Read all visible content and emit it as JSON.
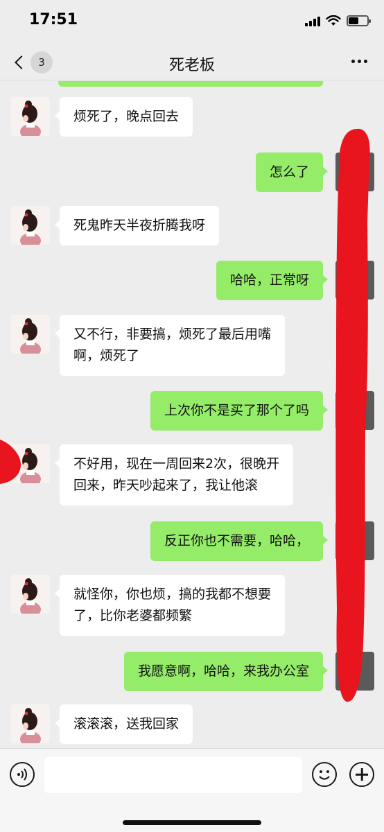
{
  "status_bar": {
    "time": "17:51"
  },
  "nav": {
    "unread_count": "3",
    "title": "死老板"
  },
  "messages": [
    {
      "from": "her",
      "lines": [
        "烦死了，晚点回去"
      ]
    },
    {
      "from": "me",
      "lines": [
        "怎么了"
      ]
    },
    {
      "from": "her",
      "lines": [
        "死鬼昨天半夜折腾我呀"
      ]
    },
    {
      "from": "me",
      "lines": [
        "哈哈，正常呀"
      ]
    },
    {
      "from": "her",
      "lines": [
        "又不行，非要搞，烦死了最后用嘴",
        "啊，烦死了"
      ]
    },
    {
      "from": "me",
      "lines": [
        "上次你不是买了那个了吗"
      ]
    },
    {
      "from": "her",
      "lines": [
        "不好用，现在一周回来2次，很晚开",
        "回来，昨天吵起来了，我让他滚"
      ]
    },
    {
      "from": "me",
      "lines": [
        "反正你也不需要，哈哈，"
      ]
    },
    {
      "from": "her",
      "lines": [
        "就怪你，你也烦，搞的我都不想要",
        "了，比你老婆都频繁"
      ]
    },
    {
      "from": "me",
      "lines": [
        "我愿意啊，哈哈，来我办公室"
      ]
    },
    {
      "from": "her",
      "lines": [
        "滚滚滚，送我回家"
      ]
    }
  ],
  "input": {
    "value": ""
  },
  "icons": {
    "back": "chevron-left-icon",
    "more": "more-dots-icon",
    "voice": "voice-icon",
    "emoji": "emoji-icon",
    "plus": "plus-icon"
  },
  "colors": {
    "outgoing_bubble": "#95ec69",
    "incoming_bubble": "#ffffff",
    "background": "#ededed",
    "scribble": "#e8141e"
  }
}
